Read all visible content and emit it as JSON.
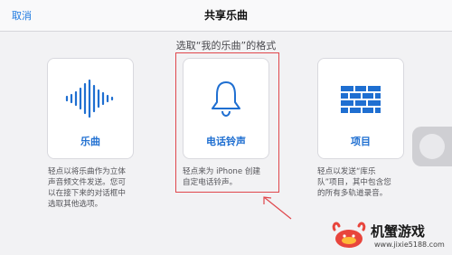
{
  "navbar": {
    "cancel_label": "取消",
    "title": "共享乐曲"
  },
  "subtitle": "选取“我的乐曲”的格式",
  "options": [
    {
      "label": "乐曲",
      "icon": "waveform-icon",
      "description": [
        "轻点以将乐曲作为立体",
        "声音频文件发送。您可",
        "以在接下来的对话框中",
        "选取其他选项。"
      ]
    },
    {
      "label": "电话铃声",
      "icon": "bell-icon",
      "description": [
        "轻点来为 iPhone 创建",
        "自定电话铃声。"
      ]
    },
    {
      "label": "项目",
      "icon": "brick-wall-icon",
      "description": [
        "轻点以发送“库乐",
        "队”项目，其中包含您",
        "的所有多轨道录音。"
      ]
    }
  ],
  "watermark": {
    "name": "机蟹游戏",
    "url": "www.jixie5188.com"
  },
  "colors": {
    "accent": "#1f6fd1",
    "highlight": "#e0474c",
    "background": "#f2f2f4"
  }
}
